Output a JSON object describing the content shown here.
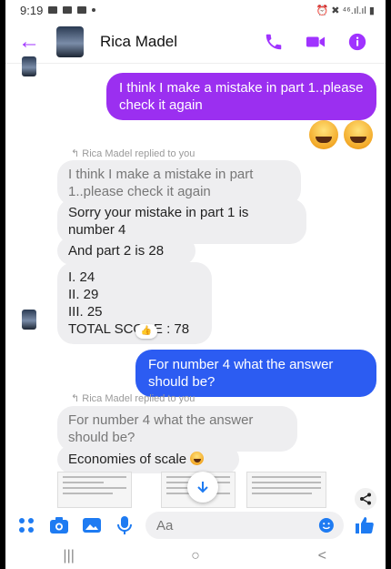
{
  "status": {
    "time": "9:19",
    "right": "⏰ ✖ ⁴⁶.ıl.ıl ▮"
  },
  "header": {
    "contact_name": "Rica Madel"
  },
  "messages": {
    "out1": "I think I make a mistake in part 1..please check it again",
    "replied_1": "Rica Madel replied to you",
    "quote_1": "I think I make a mistake in part 1..please check it again",
    "reply_a": "Sorry your mistake in part 1 is number 4",
    "reply_b": "And part 2 is 28",
    "reply_c": [
      "I. 24",
      "II. 29",
      "III. 25",
      "TOTAL SCORE : 78"
    ],
    "reaction": "👍",
    "out2": "For number 4 what the answer should be?",
    "replied_2": "Rica Madel replied to you",
    "quote_2": "For number 4 what the answer should be?",
    "reply_d": "Economies of scale"
  },
  "composer": {
    "placeholder": "Aa"
  },
  "navbar": {
    "recents": "|||",
    "home": "○",
    "back": "<"
  },
  "colors": {
    "accent": "#a033ff",
    "outgoing_purple": "#9b2ff0",
    "outgoing_blue": "#2c5cf2",
    "incoming_bg": "#eeeef0",
    "icon_blue": "#1e7bf2"
  }
}
